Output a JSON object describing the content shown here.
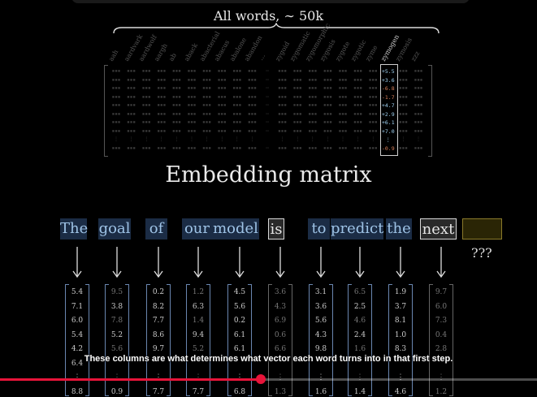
{
  "header": {
    "brace_label": "All words,  ∼ 50k"
  },
  "matrix": {
    "words": [
      "aah",
      "aardvark",
      "aardwolf",
      "aargh",
      "ab",
      "aback",
      "abacterial",
      "abacus",
      "abalone",
      "abandon",
      "⋯",
      "zygoid",
      "zygomatic",
      "zygomorphic",
      "zygosis",
      "zygote",
      "zygotic",
      "zyme",
      "zymogen",
      "zymosis",
      "zzz"
    ],
    "highlight_word": "zymogen",
    "highlight_values": [
      "+5.5",
      "+3.6",
      "-6.8",
      "-1.7",
      "+4.7",
      "+2.9",
      "+6.1",
      "+7.0",
      "⋮",
      "-0.9"
    ],
    "title": "Embedding matrix"
  },
  "tokens": [
    {
      "text": "The",
      "style": "blue"
    },
    {
      "text": "goal",
      "style": "blue"
    },
    {
      "text": "of",
      "style": "blue"
    },
    {
      "text": "our",
      "style": "blue"
    },
    {
      "text": "model",
      "style": "blue"
    },
    {
      "text": "is",
      "style": "gray"
    },
    {
      "text": "to",
      "style": "blue"
    },
    {
      "text": "predict",
      "style": "blue"
    },
    {
      "text": "the",
      "style": "blue"
    },
    {
      "text": "next",
      "style": "gray"
    }
  ],
  "unknown_label": "???",
  "vectors": [
    {
      "values": [
        "5.4",
        "7.1",
        "6.0",
        "5.4",
        "4.2",
        "6.4",
        "⋮",
        "8.8"
      ]
    },
    {
      "values": [
        "9.5",
        "3.8",
        "7.8",
        "5.2",
        "5.6",
        "",
        "⋮",
        "0.9"
      ]
    },
    {
      "values": [
        "0.2",
        "8.2",
        "7.7",
        "8.6",
        "9.7",
        "",
        "⋮",
        "7.7"
      ]
    },
    {
      "values": [
        "1.2",
        "6.3",
        "1.4",
        "9.4",
        "5.2",
        "",
        "⋮",
        "7.7"
      ]
    },
    {
      "values": [
        "4.5",
        "5.6",
        "0.2",
        "6.1",
        "6.1",
        "",
        "⋮",
        "6.8"
      ]
    },
    {
      "values": [
        "3.6",
        "4.3",
        "6.9",
        "0.6",
        "6.6",
        "",
        "⋮",
        "1.3"
      ]
    },
    {
      "values": [
        "3.1",
        "3.6",
        "5.6",
        "4.3",
        "9.8",
        "",
        "⋮",
        "1.6"
      ]
    },
    {
      "values": [
        "6.5",
        "2.5",
        "4.6",
        "2.4",
        "1.6",
        "",
        "⋮",
        "1.4"
      ]
    },
    {
      "values": [
        "1.9",
        "3.7",
        "8.1",
        "1.0",
        "8.3",
        "",
        "⋮",
        "4.6"
      ]
    },
    {
      "values": [
        "9.7",
        "6.0",
        "7.3",
        "0.4",
        "2.8",
        "",
        "⋮",
        "1.2"
      ]
    }
  ],
  "caption": "These columns are what determines what vector each word turns into in that first step.",
  "player": {
    "progress": 0.485
  },
  "colors": {
    "accent": "#e8143a",
    "token_blue": "#9ec3e6"
  }
}
